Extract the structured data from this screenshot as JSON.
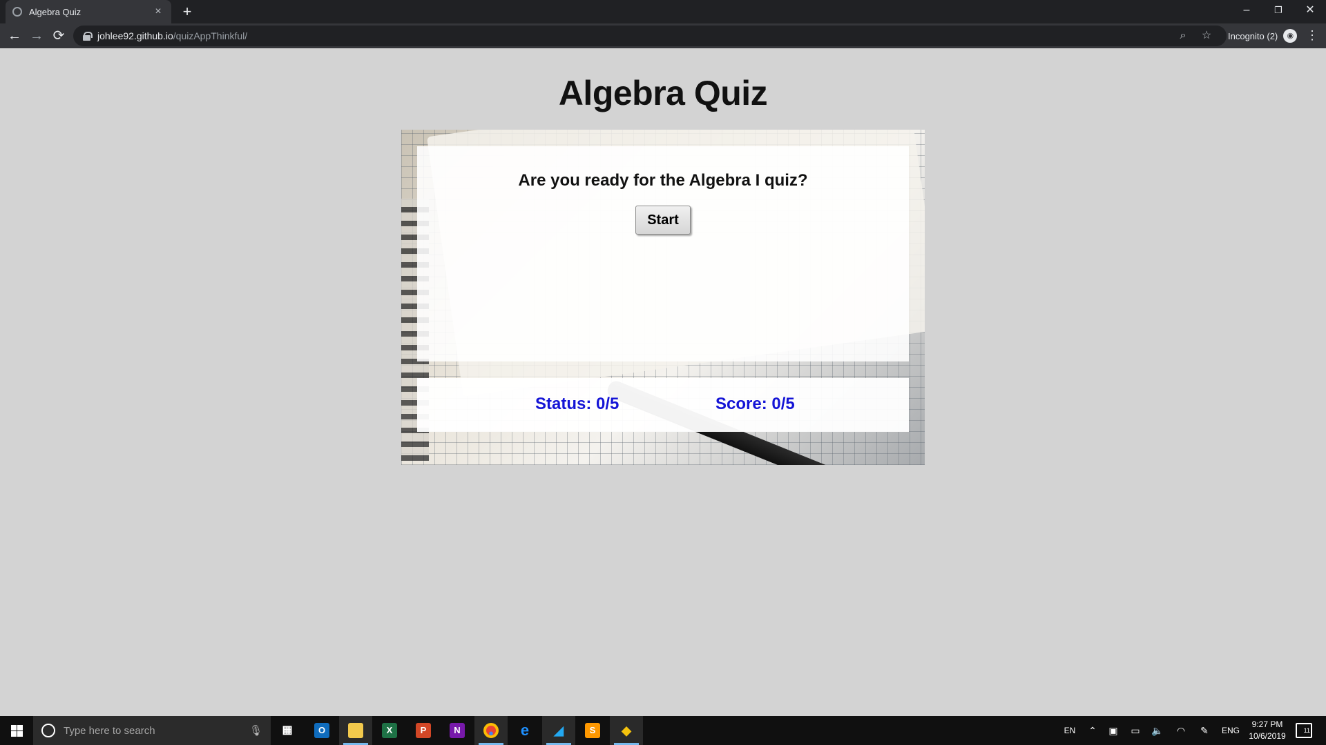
{
  "browser": {
    "tab_title": "Algebra Quiz",
    "tab_close": "×",
    "new_tab": "+",
    "url_host": "johlee92.github.io",
    "url_path": "/quizAppThinkful/",
    "incognito_label": "Incognito (2)",
    "window_controls": {
      "minimize": "–",
      "restore": "❐",
      "close": "✕"
    },
    "nav": {
      "back": "←",
      "forward": "→",
      "reload": "⟳"
    },
    "icons": {
      "zoom": "zoom-icon",
      "bookmark": "star-icon",
      "menu": "⋮"
    }
  },
  "page": {
    "title": "Algebra Quiz",
    "question": "Are you ready for the Algebra I quiz?",
    "start_label": "Start",
    "status": "Status: 0/5",
    "score": "Score: 0/5",
    "accent_color": "#1414d6"
  },
  "taskbar": {
    "search_placeholder": "Type here to search",
    "apps": [
      {
        "name": "task-view",
        "glyph": "▦"
      },
      {
        "name": "outlook",
        "glyph": "O"
      },
      {
        "name": "file-explorer",
        "glyph": "▬"
      },
      {
        "name": "excel",
        "glyph": "X"
      },
      {
        "name": "powerpoint",
        "glyph": "P"
      },
      {
        "name": "onenote",
        "glyph": "N"
      },
      {
        "name": "chrome",
        "glyph": "●"
      },
      {
        "name": "edge",
        "glyph": "e"
      },
      {
        "name": "vscode",
        "glyph": "◢"
      },
      {
        "name": "sublime",
        "glyph": "S"
      },
      {
        "name": "git",
        "glyph": "◆"
      }
    ],
    "tray": {
      "input_lang": "EN",
      "lang": "ENG",
      "time": "9:27 PM",
      "date": "10/6/2019",
      "notifications": "11"
    }
  }
}
